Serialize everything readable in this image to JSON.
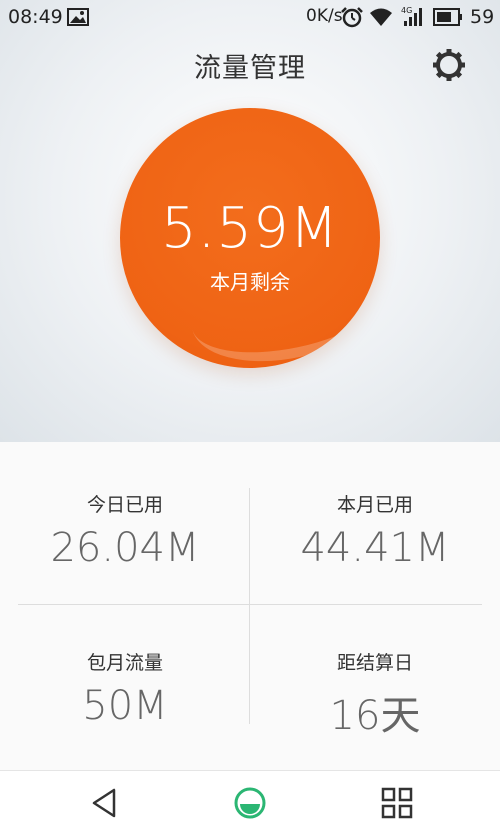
{
  "status_bar": {
    "time": "08:49",
    "speed": "0K/s",
    "battery": "59"
  },
  "header": {
    "title": "流量管理",
    "icon": "gear-icon"
  },
  "summary": {
    "remaining_value": "5.59M",
    "remaining_label": "本月剩余",
    "circle_color": "#ef6314"
  },
  "stats": [
    {
      "label": "今日已用",
      "value": "26.04M"
    },
    {
      "label": "本月已用",
      "value": "44.41M"
    },
    {
      "label": "包月流量",
      "value": "50M"
    },
    {
      "label": "距结算日",
      "value": "16天"
    }
  ],
  "navbar": {
    "items": [
      "back-icon",
      "home-icon",
      "apps-icon"
    ],
    "home_color": "#2bb673"
  }
}
